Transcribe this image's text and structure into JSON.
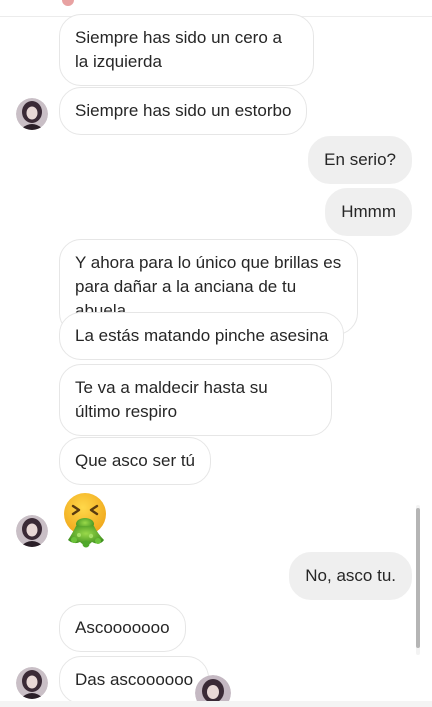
{
  "conversation": {
    "messages": [
      {
        "side": "in",
        "text": "Siempre has sido un cero a la izquierda"
      },
      {
        "side": "in",
        "text": "Siempre has sido un estorbo"
      },
      {
        "side": "out",
        "text": "En serio?"
      },
      {
        "side": "out",
        "text": "Hmmm"
      },
      {
        "side": "in",
        "text": "Y ahora para lo único que brillas es para dañar a la anciana de tu abuela"
      },
      {
        "side": "in",
        "text": "La estás matando pinche asesina"
      },
      {
        "side": "in",
        "text": "Te va a maldecir hasta su último respiro"
      },
      {
        "side": "in",
        "text": "Que asco ser tú"
      },
      {
        "side": "in",
        "type": "emoji",
        "emoji": "vomiting-face"
      },
      {
        "side": "out",
        "text": "No, asco tu."
      },
      {
        "side": "in",
        "text": "Ascooooooo"
      },
      {
        "side": "in",
        "text": "Das ascoooooo"
      }
    ]
  },
  "colors": {
    "incoming_bubble_bg": "#ffffff",
    "incoming_bubble_border": "#e6e6e6",
    "outgoing_bubble_bg": "#efefef",
    "text": "#262626"
  },
  "icons": {
    "avatar": "user-avatar",
    "emoji": "vomiting-face-emoji"
  }
}
